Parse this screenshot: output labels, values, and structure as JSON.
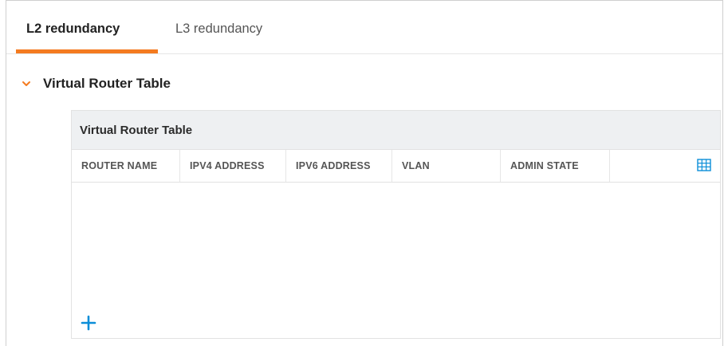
{
  "tabs": [
    {
      "label": "L2 redundancy",
      "active": true
    },
    {
      "label": "L3 redundancy",
      "active": false
    }
  ],
  "section": {
    "title": "Virtual Router Table",
    "expanded": true,
    "icon": "chevron-down-icon"
  },
  "table": {
    "title": "Virtual Router Table",
    "columns": [
      "ROUTER NAME",
      "IPV4 ADDRESS",
      "IPV6 ADDRESS",
      "VLAN",
      "ADMIN STATE"
    ],
    "rows": [],
    "grid_icon": "grid-icon",
    "add_icon": "plus-icon"
  },
  "colors": {
    "accent": "#f47b20",
    "primary_blue": "#0b8ed8",
    "header_bg": "#eef0f2"
  }
}
